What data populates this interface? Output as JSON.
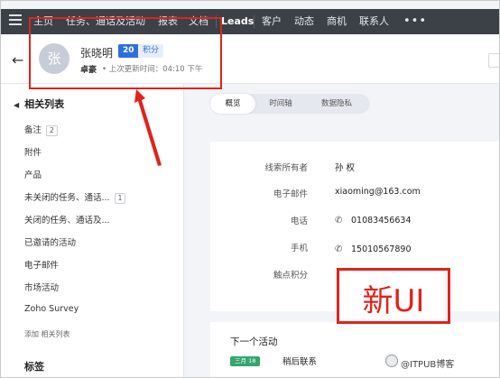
{
  "nav": {
    "items": [
      "主页",
      "任务、通话及活动",
      "报表",
      "文档",
      "Leads",
      "客户",
      "动态",
      "商机",
      "联系人"
    ],
    "active": "Leads",
    "more": "•••"
  },
  "record": {
    "avatar_char": "张",
    "name": "张晓明",
    "score": "20",
    "score_label": "积分",
    "company": "卓豪",
    "last_updated": "上次更新时间：04:10 下午"
  },
  "sidebar": {
    "title": "相关列表",
    "items": [
      {
        "label": "备注",
        "count": "2"
      },
      {
        "label": "附件",
        "count": ""
      },
      {
        "label": "产品",
        "count": ""
      },
      {
        "label": "未关闭的任务、通话...",
        "count": "1"
      },
      {
        "label": "关闭的任务、通话及...",
        "count": ""
      },
      {
        "label": "已邀请的活动",
        "count": ""
      },
      {
        "label": "电子邮件",
        "count": ""
      },
      {
        "label": "市场活动",
        "count": ""
      },
      {
        "label": "Zoho Survey",
        "count": ""
      }
    ],
    "add_link": "添加 相关列表",
    "tags_title": "标签"
  },
  "tabs": [
    "概览",
    "时间轴",
    "数据隐私"
  ],
  "active_tab": "概览",
  "fields": [
    {
      "label": "线索所有者",
      "value": "孙 权",
      "icon": ""
    },
    {
      "label": "电子邮件",
      "value": "xiaoming@163.com",
      "icon": ""
    },
    {
      "label": "电话",
      "value": "01083456634",
      "icon": "phone-icon"
    },
    {
      "label": "手机",
      "value": "15010567890",
      "icon": "phone-icon"
    },
    {
      "label": "触点积分",
      "value": "",
      "icon": ""
    }
  ],
  "annotation": {
    "text": "新UI",
    "color": "#e0231c"
  },
  "activity": {
    "title": "下一个活动",
    "date": "三月 18",
    "name": "稍后联系"
  },
  "watermark": "@ITPUB博客",
  "colors": {
    "nav_bg": "#3c4047",
    "accent": "#2f6fdc",
    "highlight": "#e0231c",
    "activity_badge": "#34a56b"
  }
}
